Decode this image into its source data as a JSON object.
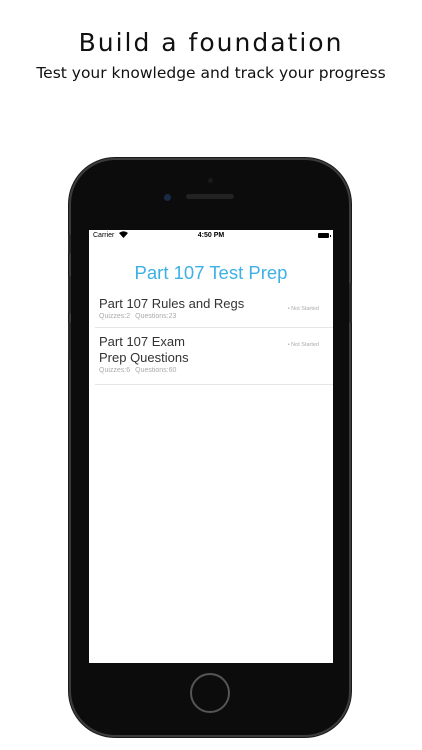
{
  "promo": {
    "headline": "Build a foundation",
    "subline": "Test your knowledge and track your progress"
  },
  "status_bar": {
    "carrier": "Carrier",
    "time": "4:50 PM"
  },
  "app": {
    "title": "Part 107 Test Prep",
    "accent_color": "#3db0e6"
  },
  "courses": [
    {
      "title": "Part 107 Rules and Regs",
      "quizzes": "Quizzes:2",
      "questions": "Questions:23",
      "status": "• Not Started"
    },
    {
      "title": "Part 107 Exam Prep Questions",
      "quizzes": "Quizzes:6",
      "questions": "Questions:60",
      "status": "• Not Started"
    }
  ]
}
